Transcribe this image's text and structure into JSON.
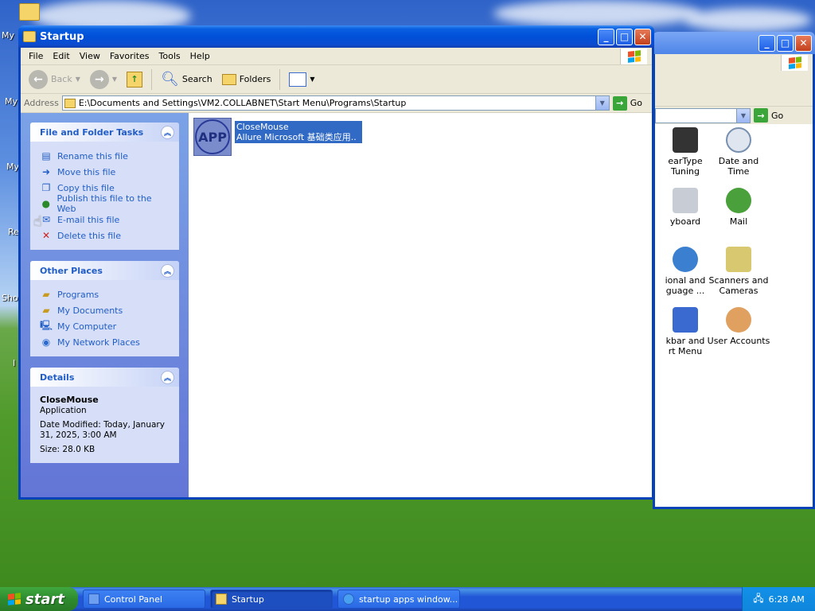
{
  "startup_window": {
    "title": "Startup",
    "menu": [
      "File",
      "Edit",
      "View",
      "Favorites",
      "Tools",
      "Help"
    ],
    "toolbar": {
      "back": "Back",
      "search": "Search",
      "folders": "Folders"
    },
    "address": {
      "label": "Address",
      "value": "E:\\Documents and Settings\\VM2.COLLABNET\\Start Menu\\Programs\\Startup",
      "go": "Go"
    },
    "file_tasks": {
      "title": "File and Folder Tasks",
      "items": [
        "Rename this file",
        "Move this file",
        "Copy this file",
        "Publish this file to the Web",
        "E-mail this file",
        "Delete this file"
      ]
    },
    "other_places": {
      "title": "Other Places",
      "items": [
        "Programs",
        "My Documents",
        "My Computer",
        "My Network Places"
      ]
    },
    "details": {
      "title": "Details",
      "name": "CloseMouse",
      "type": "Application",
      "modified": "Date Modified: Today, January 31, 2025, 3:00 AM",
      "size": "Size: 28.0 KB"
    },
    "file": {
      "name": "CloseMouse",
      "description": "Allure Microsoft 基础类应用...",
      "icon_text": "APP"
    }
  },
  "control_panel_window": {
    "address_go": "Go",
    "icons": [
      {
        "label": "earType\nTuning",
        "icon": "cleartype-icon"
      },
      {
        "label": "Date and Time",
        "icon": "clock-icon"
      },
      {
        "label": "yboard",
        "icon": "keyboard-icon"
      },
      {
        "label": "Mail",
        "icon": "mail-icon"
      },
      {
        "label": "ional and\nguage ...",
        "icon": "globe-icon"
      },
      {
        "label": "Scanners and\nCameras",
        "icon": "scanner-icon"
      },
      {
        "label": "kbar and\nrt Menu",
        "icon": "taskbar-icon"
      },
      {
        "label": "User Accounts",
        "icon": "users-icon"
      }
    ]
  },
  "desktop_labels": [
    "My",
    "My",
    "My",
    "Re",
    "Sho",
    "I"
  ],
  "taskbar": {
    "start": "start",
    "tasks": [
      "Control Panel",
      "Startup",
      "startup apps window..."
    ],
    "clock": "6:28 AM"
  }
}
